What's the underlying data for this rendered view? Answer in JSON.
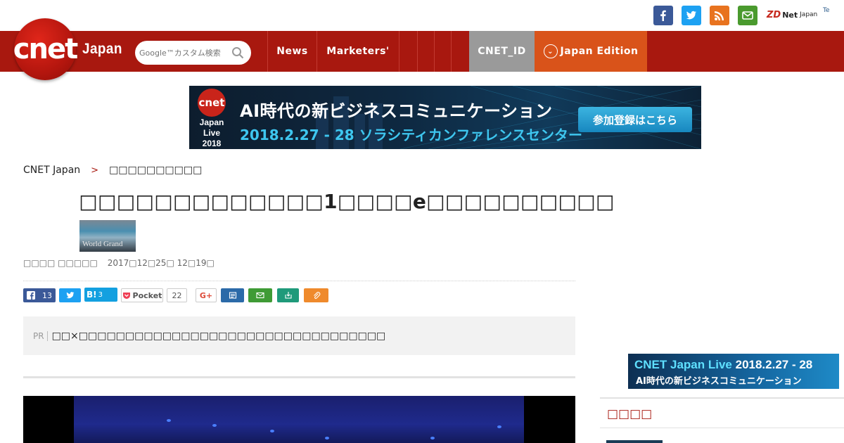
{
  "topbar": {
    "social": [
      {
        "name": "facebook",
        "color": "#3b5998"
      },
      {
        "name": "twitter",
        "color": "#1da1f2"
      },
      {
        "name": "rss",
        "color": "#e8731f"
      },
      {
        "name": "mail",
        "color": "#4a9a2e"
      }
    ],
    "zdnet_prefix": "ZD",
    "zdnet_label": "Net",
    "zdnet_suffix": "Japan",
    "techrepublic_label": "Te"
  },
  "nav": {
    "logo_text": "cnet",
    "logo_sub": "Japan",
    "search_placeholder": "Google™カスタム検索",
    "items": [
      "News",
      "Marketers'"
    ],
    "cnet_id": "CNET_ID",
    "edition": "Japan Edition"
  },
  "banner": {
    "logo_lines": [
      "Japan",
      "Live",
      "2018"
    ],
    "headline": "AI時代の新ビジネスコミュニケーション",
    "date_line": "2018.2.27 - 28 ソラシティカンファレンスセンター",
    "cta": "参加登録はこちら"
  },
  "breadcrumb": {
    "home": "CNET Japan",
    "separator": ">",
    "current": "□□□□□□□□□□"
  },
  "article": {
    "title": "□□□□□□□□□□□□□1□□□□e□□□□□□□□□□",
    "thumb_text": "World Grand",
    "author": "□□□□ □□□□□",
    "date": "2017□12□25□ 12□19□"
  },
  "share": {
    "facebook_count": "13",
    "hatena_label": "B!",
    "hatena_count": "3",
    "pocket_label": "Pocket",
    "pocket_count": "22",
    "google_label": "G+"
  },
  "pr": {
    "label": "PR",
    "text": "□□×□□□□□□□□□□□□□□□□□□□□□□□□□□□□□□□□□"
  },
  "sidebar": {
    "ad_line1_a": "CNET Japan Live",
    "ad_line1_b": "2018.2.27 - 28",
    "ad_line2": "AI時代の新ビジネスコミュニケーション",
    "heading": "□□□□"
  }
}
